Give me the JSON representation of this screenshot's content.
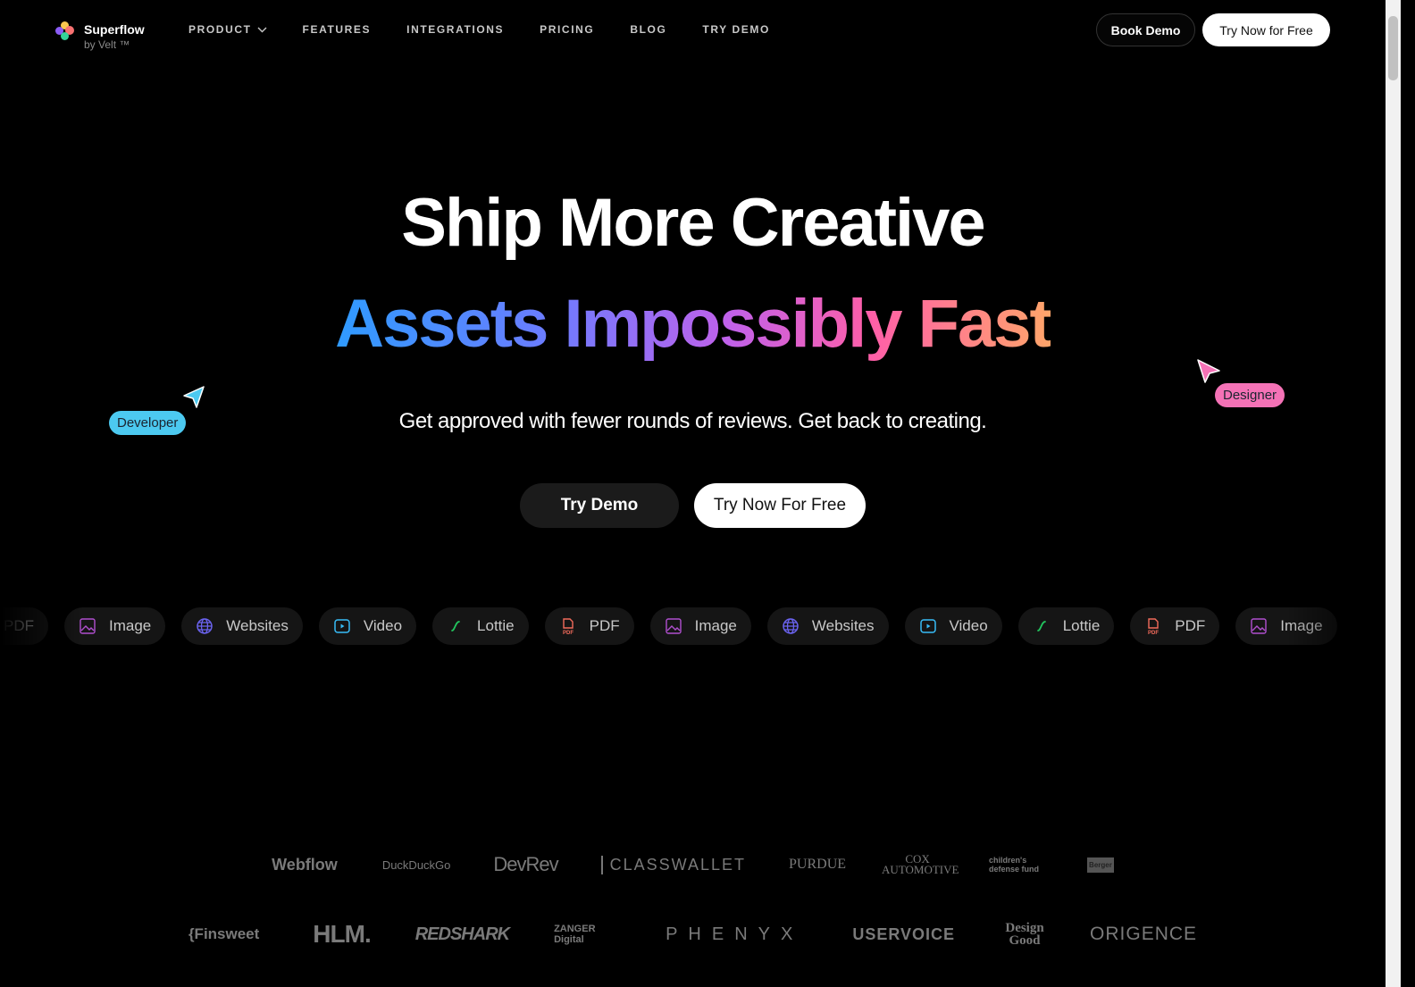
{
  "nav": {
    "brand": "Superflow",
    "brand_sub": "by Velt ™",
    "items": [
      {
        "label": "PRODUCT",
        "dropdown": true
      },
      {
        "label": "FEATURES"
      },
      {
        "label": "INTEGRATIONS"
      },
      {
        "label": "PRICING"
      },
      {
        "label": "BLOG"
      },
      {
        "label": "TRY DEMO"
      }
    ],
    "book_demo": "Book Demo",
    "try_free": "Try Now for Free"
  },
  "hero": {
    "title_line1": "Ship More Creative",
    "title_line2": "Assets Impossibly Fast",
    "subtitle": "Get approved with fewer rounds of reviews. Get back to creating.",
    "cta_demo": "Try Demo",
    "cta_free": "Try Now For Free"
  },
  "cursors": {
    "developer": {
      "label": "Developer",
      "color": "#4cc9f0"
    },
    "designer": {
      "label": "Designer",
      "color": "#f472b6"
    }
  },
  "chips": [
    {
      "label": "PDF",
      "icon": "pdf-icon"
    },
    {
      "label": "Image",
      "icon": "image-icon"
    },
    {
      "label": "Websites",
      "icon": "globe-icon"
    },
    {
      "label": "Video",
      "icon": "play-icon"
    },
    {
      "label": "Lottie",
      "icon": "lottie-icon"
    },
    {
      "label": "PDF",
      "icon": "pdf-icon"
    },
    {
      "label": "Image",
      "icon": "image-icon"
    },
    {
      "label": "Websites",
      "icon": "globe-icon"
    },
    {
      "label": "Video",
      "icon": "play-icon"
    },
    {
      "label": "Lottie",
      "icon": "lottie-icon"
    },
    {
      "label": "PDF",
      "icon": "pdf-icon"
    },
    {
      "label": "Image",
      "icon": "image-icon"
    }
  ],
  "logos_row1": [
    "Webflow",
    "DuckDuckGo",
    "DevRev",
    "CLASSWALLET",
    "PURDUE",
    "COX AUTOMOTIVE",
    "children's defense fund",
    "Berger"
  ],
  "logos_row2": [
    "{Finsweet",
    "HLM.",
    "REDSHARK",
    "ZANGER Digital",
    "PHENYX",
    "USERVOICE",
    "Design Good",
    "ORIGENCE"
  ]
}
